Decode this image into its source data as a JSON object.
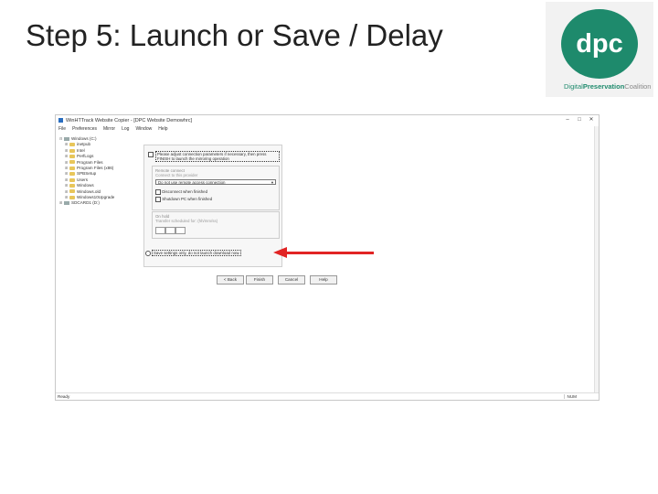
{
  "slide": {
    "title": "Step 5: Launch or Save / Delay"
  },
  "logo": {
    "letters": "dpc",
    "text_pre": "Digital",
    "text_mid": "Preservation",
    "text_post": "Coalition",
    "brand_color": "#1e8a6c"
  },
  "window": {
    "title": "WinHTTrack Website Copier - [DPC Website Demowhrc]",
    "controls": {
      "minimize": "–",
      "maximize": "□",
      "close": "✕"
    },
    "menu": [
      "File",
      "Preferences",
      "Mirror",
      "Log",
      "Window",
      "Help"
    ]
  },
  "tree": [
    {
      "expander": "⊟",
      "icon": "drive",
      "label": "Windows (C:)"
    },
    {
      "expander": "⊞",
      "icon": "folder",
      "label": "inetpub"
    },
    {
      "expander": "⊞",
      "icon": "folder",
      "label": "Intel"
    },
    {
      "expander": "⊞",
      "icon": "folder",
      "label": "PerfLogs"
    },
    {
      "expander": "⊞",
      "icon": "folder",
      "label": "Program Files"
    },
    {
      "expander": "⊞",
      "icon": "folder",
      "label": "Program Files (x86)"
    },
    {
      "expander": "⊞",
      "icon": "folder",
      "label": "SPBSetup"
    },
    {
      "expander": "⊞",
      "icon": "folder",
      "label": "Users"
    },
    {
      "expander": "⊞",
      "icon": "folder",
      "label": "Windows"
    },
    {
      "expander": "⊞",
      "icon": "folder",
      "label": "Windows.old"
    },
    {
      "expander": "⊞",
      "icon": "folder",
      "label": "Windows10Upgrade"
    },
    {
      "expander": "⊞",
      "icon": "drive",
      "label": "SDCARD1 (D:)"
    }
  ],
  "panel": {
    "adjust_params_label": "Please adjust connection parameters if necessary, then press FINISH to launch the mirroring operation",
    "group1_label": "Remote connect",
    "group1_sub": "Connect to this provider",
    "connection_select": "Do not use remote access connection",
    "disconnect_label": "Disconnect when finished",
    "shutdown_label": "Shutdown PC when finished",
    "group2_label": "On hold",
    "group2_sub": "Transfer scheduled for: (hh/mm/ss)",
    "save_only_label": "Save settings only, do not launch download now."
  },
  "buttons": {
    "back": "< Back",
    "finish": "Finish",
    "cancel": "Cancel",
    "help": "Help"
  },
  "status": {
    "left": "Ready",
    "right": "NUM"
  },
  "annotation": {
    "arrow_color": "#e12424"
  }
}
